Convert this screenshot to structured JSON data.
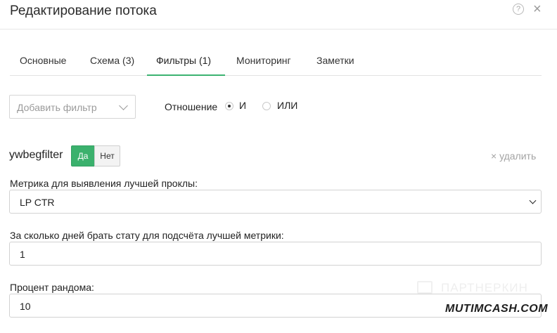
{
  "header": {
    "title": "Редактирование потока",
    "help_icon": "?",
    "close_icon": "×"
  },
  "tabs": [
    {
      "label": "Основные",
      "active": false
    },
    {
      "label": "Схема (3)",
      "active": false
    },
    {
      "label": "Фильтры (1)",
      "active": true
    },
    {
      "label": "Мониторинг",
      "active": false
    },
    {
      "label": "Заметки",
      "active": false
    }
  ],
  "filters_bar": {
    "add_filter_placeholder": "Добавить фильтр",
    "relation_label": "Отношение",
    "relation_options": [
      {
        "label": "И",
        "checked": true
      },
      {
        "label": "ИЛИ",
        "checked": false
      }
    ]
  },
  "filter": {
    "name": "ywbegfilter",
    "yes_label": "Да",
    "no_label": "Нет",
    "yes_active": true,
    "delete_label": "× удалить"
  },
  "fields": {
    "metric_label": "Метрика для выявления лучшей проклы:",
    "metric_value": "LP CTR",
    "days_label": "За сколько дней брать стату для подсчёта лучшей метрики:",
    "days_value": "1",
    "random_label": "Процент рандома:",
    "random_value": "10"
  },
  "watermarks": {
    "partnerkin": "ПАРТНЕРКИН",
    "mutimcash": "MUTIMCASH.COM"
  },
  "colors": {
    "accent_green": "#3bb16d",
    "border": "#d2d2d2",
    "muted_text": "#9b9b9b"
  }
}
